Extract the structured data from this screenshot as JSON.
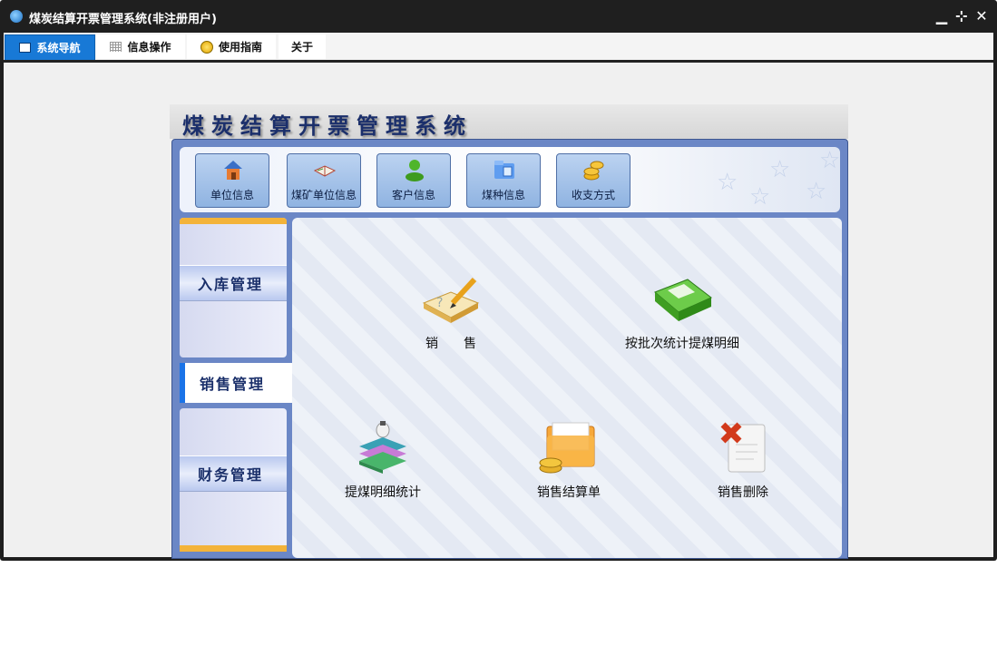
{
  "window": {
    "title": "煤炭结算开票管理系统(非注册用户)",
    "min": "▁",
    "restore": "⊹",
    "close": "✕"
  },
  "menu": {
    "tabs": [
      "系统导航",
      "信息操作",
      "使用指南",
      "关于"
    ]
  },
  "banner": {
    "title": "煤炭结算开票管理系统"
  },
  "toolbar": {
    "buttons": [
      "单位信息",
      "煤矿单位信息",
      "客户信息",
      "煤种信息",
      "收支方式"
    ]
  },
  "sidebar": {
    "items": [
      "入库管理",
      "销售管理",
      "财务管理"
    ],
    "active": "销售管理"
  },
  "features": [
    "销　　售",
    "按批次统计提煤明细",
    "提煤明细统计",
    "销售结算单",
    "销售删除"
  ],
  "colors": {
    "accent": "#1879d6",
    "frame": "#6b87c6",
    "sidebar_bar": "#f3b33a",
    "title_text": "#1b2f6b"
  }
}
